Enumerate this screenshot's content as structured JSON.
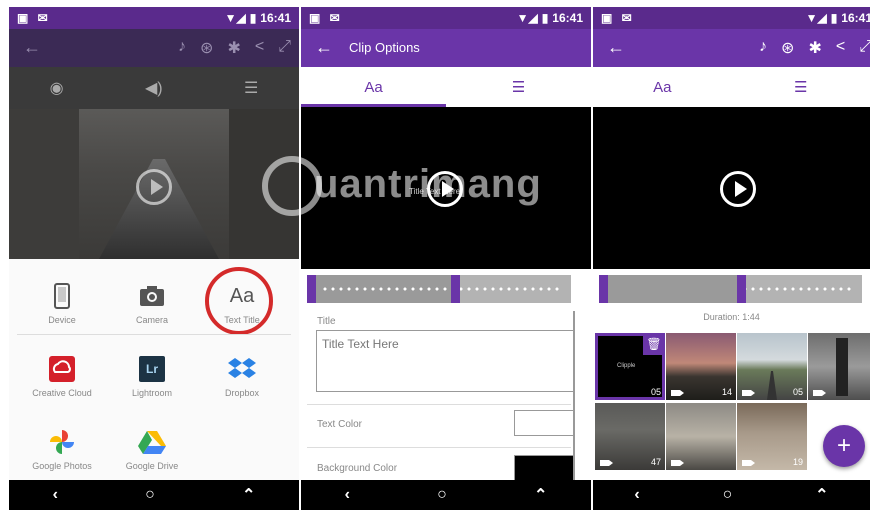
{
  "status": {
    "time": "16:41",
    "left_icons": "▣ ✉"
  },
  "panel1": {
    "tabs": [
      "camera-icon",
      "volume-icon",
      "sliders-icon"
    ],
    "sources": [
      {
        "label": "Device",
        "icon": "phone-icon"
      },
      {
        "label": "Camera",
        "icon": "camera-icon"
      },
      {
        "label": "Text Title",
        "icon": "text-aa-icon",
        "glyph": "Aa"
      },
      {
        "label": "Creative Cloud",
        "icon": "creative-cloud-icon"
      },
      {
        "label": "Lightroom",
        "icon": "lightroom-icon",
        "glyph": "Lr"
      },
      {
        "label": "Dropbox",
        "icon": "dropbox-icon"
      },
      {
        "label": "Google Photos",
        "icon": "google-photos-icon"
      },
      {
        "label": "Google Drive",
        "icon": "google-drive-icon"
      }
    ]
  },
  "panel2": {
    "appbar_title": "Clip Options",
    "tabs": {
      "text": "Aa",
      "settings_icon": "sliders-icon"
    },
    "video_caption": "Title Text Here",
    "title_label": "Title",
    "title_placeholder": "Title Text Here",
    "text_color_label": "Text Color",
    "text_color": "#ffffff",
    "background_color_label": "Background Color",
    "background_color": "#000000"
  },
  "panel3": {
    "tabs": {
      "text": "Aa",
      "settings_icon": "sliders-icon"
    },
    "duration": "Duration: 1:44",
    "clips": [
      {
        "duration": "05",
        "selected": true,
        "caption": "Clipple"
      },
      {
        "duration": "14"
      },
      {
        "duration": "05"
      },
      {
        "duration": ""
      },
      {
        "duration": "47"
      },
      {
        "duration": ""
      },
      {
        "duration": "19"
      }
    ],
    "fab": "+"
  },
  "watermark": "uantrimang",
  "colors": {
    "purple_dark": "#5a2a8c",
    "purple": "#6a35a8",
    "highlight_red": "#d42a2a"
  }
}
